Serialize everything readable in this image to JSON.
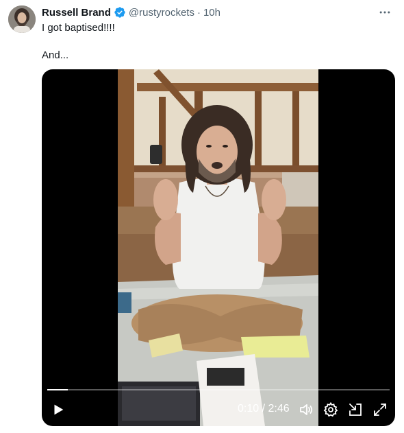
{
  "tweet": {
    "author_name": "Russell Brand",
    "handle": "@rustyrockets",
    "separator": "·",
    "time": "10h",
    "text": "I got baptised!!!!\n\nAnd...",
    "more_icon": "more-horizontal-icon",
    "verified_icon": "verified-badge-icon",
    "accent_color": "#1d9bf0"
  },
  "video": {
    "current_time": "0:10",
    "duration": "2:46",
    "time_display": "0:10 / 2:46",
    "progress_fraction": 0.06,
    "controls": [
      "play-icon",
      "volume-icon",
      "settings-icon",
      "dock-icon",
      "fullscreen-icon"
    ]
  }
}
